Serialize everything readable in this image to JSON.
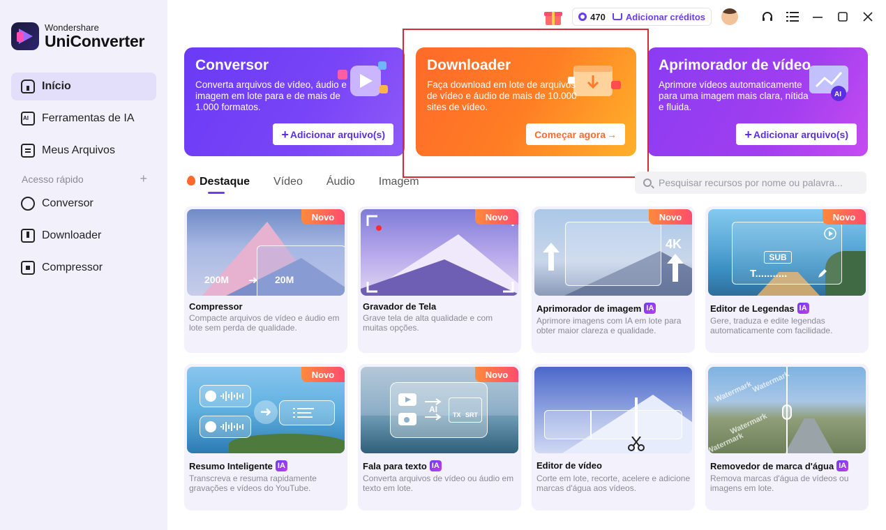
{
  "app": {
    "brand": "Wondershare",
    "product": "UniConverter"
  },
  "sidebar": {
    "items": [
      {
        "label": "Início",
        "icon": "home-icon",
        "active": true
      },
      {
        "label": "Ferramentas de IA",
        "icon": "ai-tools-icon"
      },
      {
        "label": "Meus Arquivos",
        "icon": "files-icon"
      }
    ],
    "quick_access_label": "Acesso rápido",
    "quick_items": [
      {
        "label": "Conversor",
        "icon": "converter-icon"
      },
      {
        "label": "Downloader",
        "icon": "downloader-icon"
      },
      {
        "label": "Compressor",
        "icon": "compressor-icon"
      }
    ]
  },
  "topbar": {
    "credits": "470",
    "add_credits": "Adicionar créditos"
  },
  "hero": [
    {
      "title": "Conversor",
      "desc": "Converta arquivos de vídeo, áudio e imagem em lote para e de mais de 1.000 formatos.",
      "cta": "Adicionar arquivo(s)"
    },
    {
      "title": "Downloader",
      "desc": "Faça download em lote de arquivos de vídeo e áudio de mais de 10.000 sites de vídeo.",
      "cta": "Começar agora"
    },
    {
      "title": "Aprimorador de vídeo",
      "desc": "Aprimore vídeos automaticamente para uma imagem mais clara, nítida e fluida.",
      "cta": "Adicionar arquivo(s)"
    }
  ],
  "tabs": [
    "Destaque",
    "Vídeo",
    "Áudio",
    "Imagem"
  ],
  "search": {
    "placeholder": "Pesquisar recursos por nome ou palavra..."
  },
  "cards": [
    {
      "title": "Compressor",
      "desc": "Compacte arquivos de vídeo e áudio em lote sem perda de qualidade.",
      "badge": "Novo",
      "ia": false,
      "thumb_labels": [
        "200M",
        "20M"
      ]
    },
    {
      "title": "Gravador de Tela",
      "desc": "Grave tela de alta qualidade e com muitas opções.",
      "badge": "Novo",
      "ia": false
    },
    {
      "title": "Aprimorador de imagem",
      "desc": "Aprimore imagens com IA em lote para obter maior clareza e qualidade.",
      "badge": "Novo",
      "ia": true,
      "thumb_labels": [
        "4K"
      ]
    },
    {
      "title": "Editor de Legendas",
      "desc": "Gere, traduza e edite legendas automaticamente com facilidade.",
      "badge": "Novo",
      "ia": true,
      "thumb_labels": [
        "SUB",
        "T..........."
      ]
    },
    {
      "title": "Resumo Inteligente",
      "desc": "Transcreva e resuma rapidamente gravações e vídeos do YouTube.",
      "badge": "Novo",
      "ia": true
    },
    {
      "title": "Fala para texto",
      "desc": "Converta arquivos de vídeo ou áudio em texto em lote.",
      "badge": "Novo",
      "ia": true,
      "thumb_labels": [
        "AI",
        "TX",
        "SRT"
      ]
    },
    {
      "title": "Editor de vídeo",
      "desc": "Corte em lote, recorte, acelere e adicione marcas d'água aos vídeos.",
      "badge": "",
      "ia": false
    },
    {
      "title": "Removedor de marca d'água",
      "desc": "Remova marcas d'água de vídeos ou imagens em lote.",
      "badge": "",
      "ia": true,
      "thumb_labels": [
        "Watermark"
      ]
    }
  ],
  "ia_label": "IA",
  "colors": {
    "accent": "#6b3cf0",
    "highlight": "#d42a33",
    "badge": "#ff4d6d"
  }
}
